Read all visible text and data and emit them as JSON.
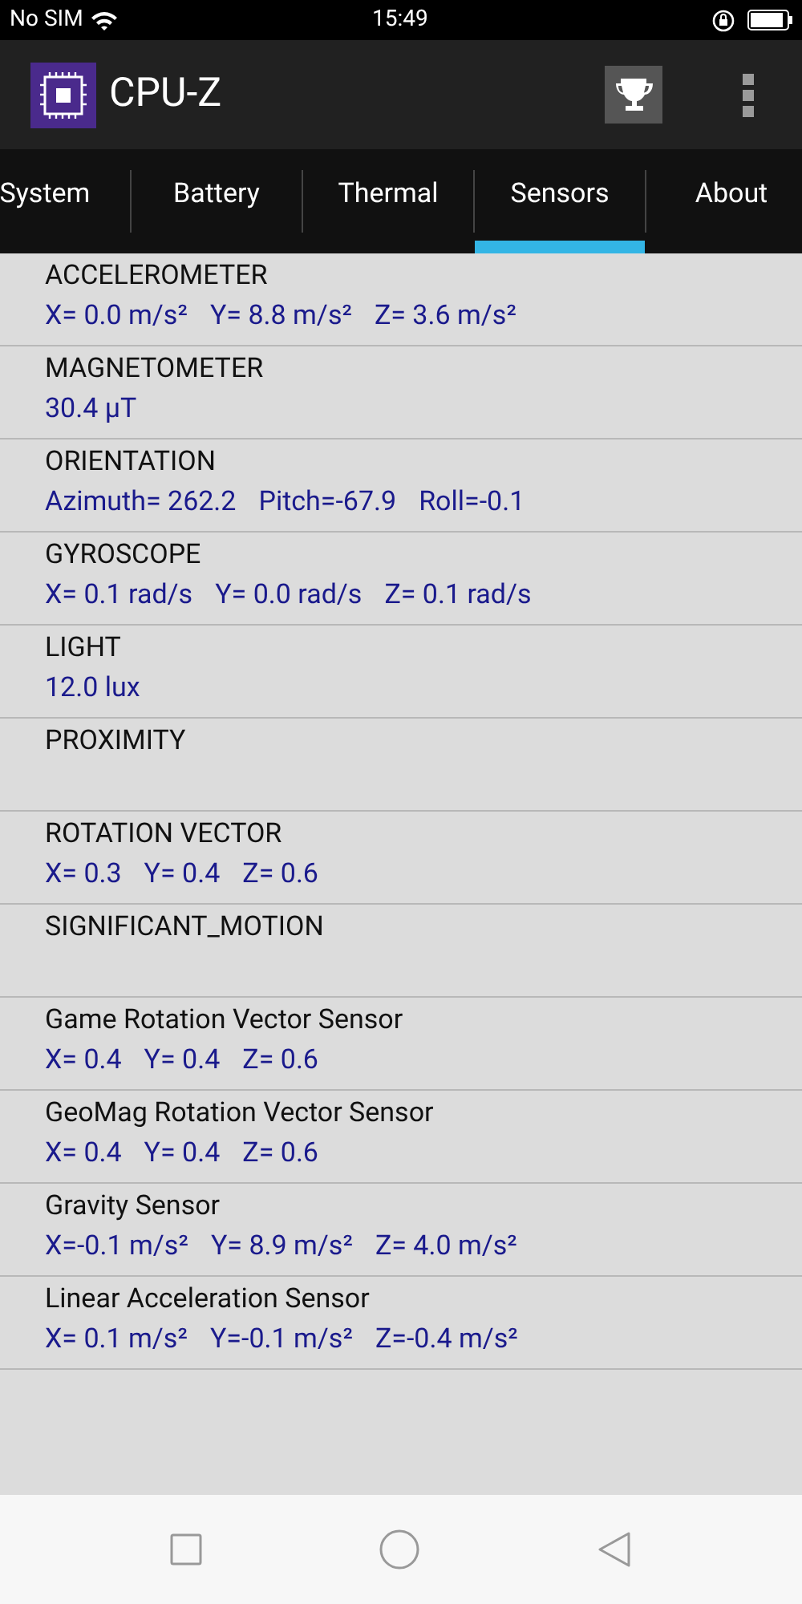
{
  "status_bar": {
    "carrier": "No SIM",
    "time": "15:49"
  },
  "app_bar": {
    "title": "CPU-Z"
  },
  "tabs": [
    {
      "label": "System",
      "selected": false
    },
    {
      "label": "Battery",
      "selected": false
    },
    {
      "label": "Thermal",
      "selected": false
    },
    {
      "label": "Sensors",
      "selected": true
    },
    {
      "label": "About",
      "selected": false
    }
  ],
  "sensors": [
    {
      "name": "ACCELEROMETER",
      "values": [
        "X= 0.0 m/s²",
        "Y= 8.8 m/s²",
        "Z= 3.6 m/s²"
      ]
    },
    {
      "name": "MAGNETOMETER",
      "values": [
        "30.4 µT"
      ]
    },
    {
      "name": "ORIENTATION",
      "values": [
        "Azimuth= 262.2",
        "Pitch=-67.9",
        "Roll=-0.1"
      ]
    },
    {
      "name": "GYROSCOPE",
      "values": [
        "X= 0.1 rad/s",
        "Y= 0.0 rad/s",
        "Z= 0.1 rad/s"
      ]
    },
    {
      "name": "LIGHT",
      "values": [
        "12.0 lux"
      ]
    },
    {
      "name": "PROXIMITY"
    },
    {
      "name": "ROTATION VECTOR",
      "values": [
        "X= 0.3",
        "Y= 0.4",
        "Z= 0.6"
      ]
    },
    {
      "name": "SIGNIFICANT_MOTION"
    },
    {
      "name": "Game Rotation Vector Sensor",
      "values": [
        "X= 0.4",
        "Y= 0.4",
        "Z= 0.6"
      ]
    },
    {
      "name": "GeoMag Rotation Vector Sensor",
      "values": [
        "X= 0.4",
        "Y= 0.4",
        "Z= 0.6"
      ]
    },
    {
      "name": "Gravity Sensor",
      "values": [
        "X=-0.1 m/s²",
        "Y= 8.9 m/s²",
        "Z= 4.0 m/s²"
      ]
    },
    {
      "name": "Linear Acceleration Sensor",
      "values": [
        "X= 0.1 m/s²",
        "Y=-0.1 m/s²",
        "Z=-0.4 m/s²"
      ]
    }
  ]
}
